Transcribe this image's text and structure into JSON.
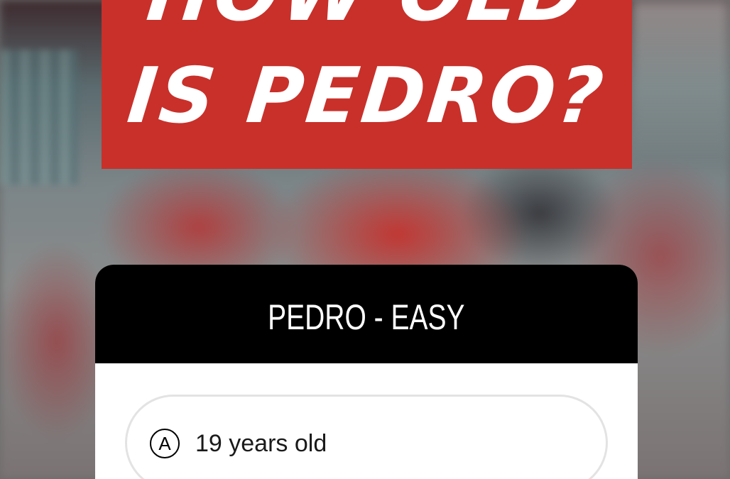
{
  "headline": {
    "line1": "HOW OLD",
    "line2": "IS PEDRO?"
  },
  "quiz": {
    "title": "PEDRO - EASY",
    "options": [
      {
        "letter": "A",
        "label": "19 years old"
      }
    ]
  },
  "colors": {
    "headline_bg": "#c9302a",
    "card_header_bg": "#000000",
    "card_body_bg": "#ffffff"
  }
}
